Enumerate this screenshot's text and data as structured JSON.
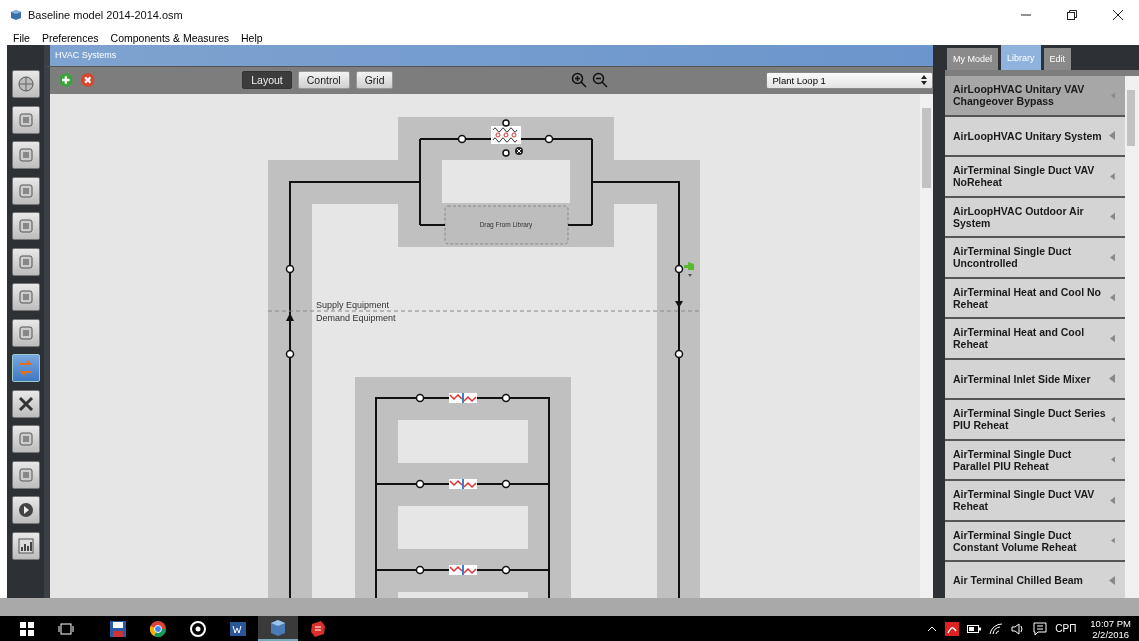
{
  "window": {
    "title": "Baseline model 2014-2014.osm"
  },
  "menu": [
    "File",
    "Preferences",
    "Components & Measures",
    "Help"
  ],
  "sidebar_tools": [
    {
      "selected": false
    },
    {
      "selected": false
    },
    {
      "selected": false
    },
    {
      "selected": false
    },
    {
      "selected": false
    },
    {
      "selected": false
    },
    {
      "selected": false
    },
    {
      "selected": false
    },
    {
      "selected": true
    },
    {
      "selected": false
    },
    {
      "selected": false
    },
    {
      "selected": false
    },
    {
      "selected": false
    },
    {
      "selected": false
    }
  ],
  "panel": {
    "title": "HVAC Systems",
    "view_buttons": [
      {
        "label": "Layout",
        "selected": true
      },
      {
        "label": "Control",
        "selected": false
      },
      {
        "label": "Grid",
        "selected": false
      }
    ],
    "loop_select": {
      "value": "Plant Loop 1"
    }
  },
  "canvas": {
    "drop_zone": "Drag From Library",
    "supply_label": "Supply Equipment",
    "demand_label": "Demand Equipment"
  },
  "library": {
    "tabs": [
      {
        "label": "My Model",
        "selected": false
      },
      {
        "label": "Library",
        "selected": true
      },
      {
        "label": "Edit",
        "selected": false
      }
    ],
    "items": [
      {
        "label": "AirLoopHVAC Unitary VAV Changeover Bypass",
        "selected": true
      },
      {
        "label": "AirLoopHVAC Unitary System",
        "selected": false
      },
      {
        "label": "AirTerminal Single Duct VAV NoReheat",
        "selected": false
      },
      {
        "label": "AirLoopHVAC Outdoor Air System",
        "selected": false
      },
      {
        "label": "AirTerminal Single Duct Uncontrolled",
        "selected": false
      },
      {
        "label": "AirTerminal Heat and Cool No Reheat",
        "selected": false
      },
      {
        "label": "AirTerminal Heat and Cool Reheat",
        "selected": false
      },
      {
        "label": "AirTerminal Inlet Side Mixer",
        "selected": false
      },
      {
        "label": "AirTerminal Single Duct Series PIU Reheat",
        "selected": false
      },
      {
        "label": "AirTerminal Single Duct Parallel PIU Reheat",
        "selected": false
      },
      {
        "label": "AirTerminal Single Duct VAV Reheat",
        "selected": false
      },
      {
        "label": "AirTerminal Single Duct Constant Volume Reheat",
        "selected": false
      },
      {
        "label": "Air Terminal Chilled Beam",
        "selected": false
      }
    ]
  },
  "taskbar": {
    "apps": [
      {
        "selected": false
      },
      {
        "selected": false
      },
      {
        "selected": false
      },
      {
        "selected": false
      },
      {
        "selected": true
      },
      {
        "selected": false
      }
    ],
    "language": "СРП",
    "time": "10:07 PM",
    "date": "2/2/2016"
  }
}
